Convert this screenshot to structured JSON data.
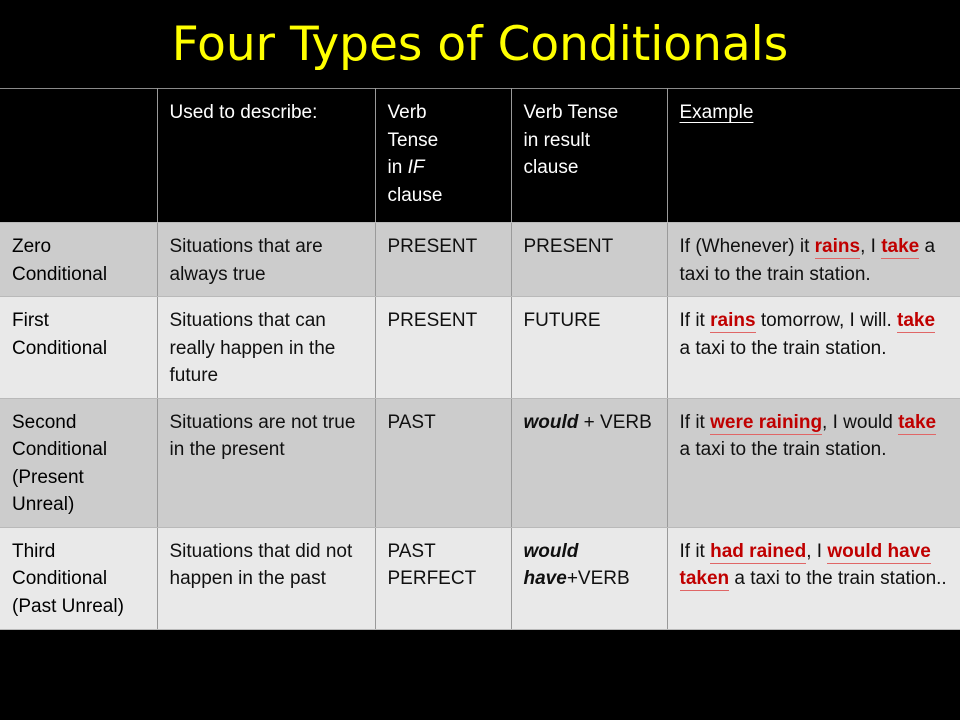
{
  "slide": {
    "title": "Four Types of Conditionals",
    "title_color": "#ffff00",
    "background_color": "#000000",
    "highlight_color": "#c00000",
    "highlight_underline_color": "#e06666",
    "row_shade_dark": "#cccccc",
    "row_shade_light": "#e9e9e9"
  },
  "table": {
    "headers": {
      "corner": "",
      "used_to_describe": "Used to describe:",
      "verb_tense_if_line1": "Verb",
      "verb_tense_if_line2": "Tense",
      "verb_tense_if_line3_pre": " in ",
      "verb_tense_if_line3_ital": "IF",
      "verb_tense_if_line4": "clause",
      "verb_tense_result_line1": "Verb  Tense",
      "verb_tense_result_line2": "in result",
      "verb_tense_result_line3": "clause",
      "example": "Example"
    },
    "rows": [
      {
        "label_line1": "Zero",
        "label_line2": "Conditional",
        "label_line3": "",
        "describe": "Situations that are always true",
        "tense_if": "PRESENT",
        "tense_result_bold": "",
        "tense_result_plain": "PRESENT",
        "example_parts": [
          {
            "text": "If (Whenever) it ",
            "highlight": false
          },
          {
            "text": "rains",
            "highlight": true
          },
          {
            "text": ", I ",
            "highlight": false
          },
          {
            "text": "take",
            "highlight": true
          },
          {
            "text": " a taxi to the train station.",
            "highlight": false
          }
        ],
        "shade": "dark"
      },
      {
        "label_line1": "First",
        "label_line2": "Conditional",
        "label_line3": "",
        "describe": "Situations that can really happen in the future",
        "tense_if": "PRESENT",
        "tense_result_bold": "",
        "tense_result_plain": "FUTURE",
        "example_parts": [
          {
            "text": "If it ",
            "highlight": false
          },
          {
            "text": "rains",
            "highlight": true
          },
          {
            "text": " tomorrow, I will. ",
            "highlight": false
          },
          {
            "text": "take",
            "highlight": true
          },
          {
            "text": " a taxi to the train station.",
            "highlight": false
          }
        ],
        "shade": "light"
      },
      {
        "label_line1": "Second",
        "label_line2": "Conditional",
        "label_line3": "(Present Unreal)",
        "describe": "Situations  are not true in the present",
        "tense_if": "PAST",
        "tense_result_bold": "would",
        "tense_result_plain": " + VERB",
        "example_parts": [
          {
            "text": "If it ",
            "highlight": false
          },
          {
            "text": "were raining",
            "highlight": true
          },
          {
            "text": ", I would ",
            "highlight": false
          },
          {
            "text": "take",
            "highlight": true
          },
          {
            "text": " a taxi to the train station.",
            "highlight": false
          }
        ],
        "shade": "dark"
      },
      {
        "label_line1": "Third",
        "label_line2": "Conditional",
        "label_line3": "(Past Unreal)",
        "describe": "Situations that did not happen in the past",
        "tense_if": "PAST PERFECT",
        "tense_result_bold": "would have",
        "tense_result_plain": "+VERB",
        "example_parts": [
          {
            "text": "If it ",
            "highlight": false
          },
          {
            "text": "had rained",
            "highlight": true
          },
          {
            "text": ", I ",
            "highlight": false
          },
          {
            "text": "would have taken",
            "highlight": true
          },
          {
            "text": " a taxi to the train station..",
            "highlight": false
          }
        ],
        "shade": "light"
      }
    ]
  }
}
